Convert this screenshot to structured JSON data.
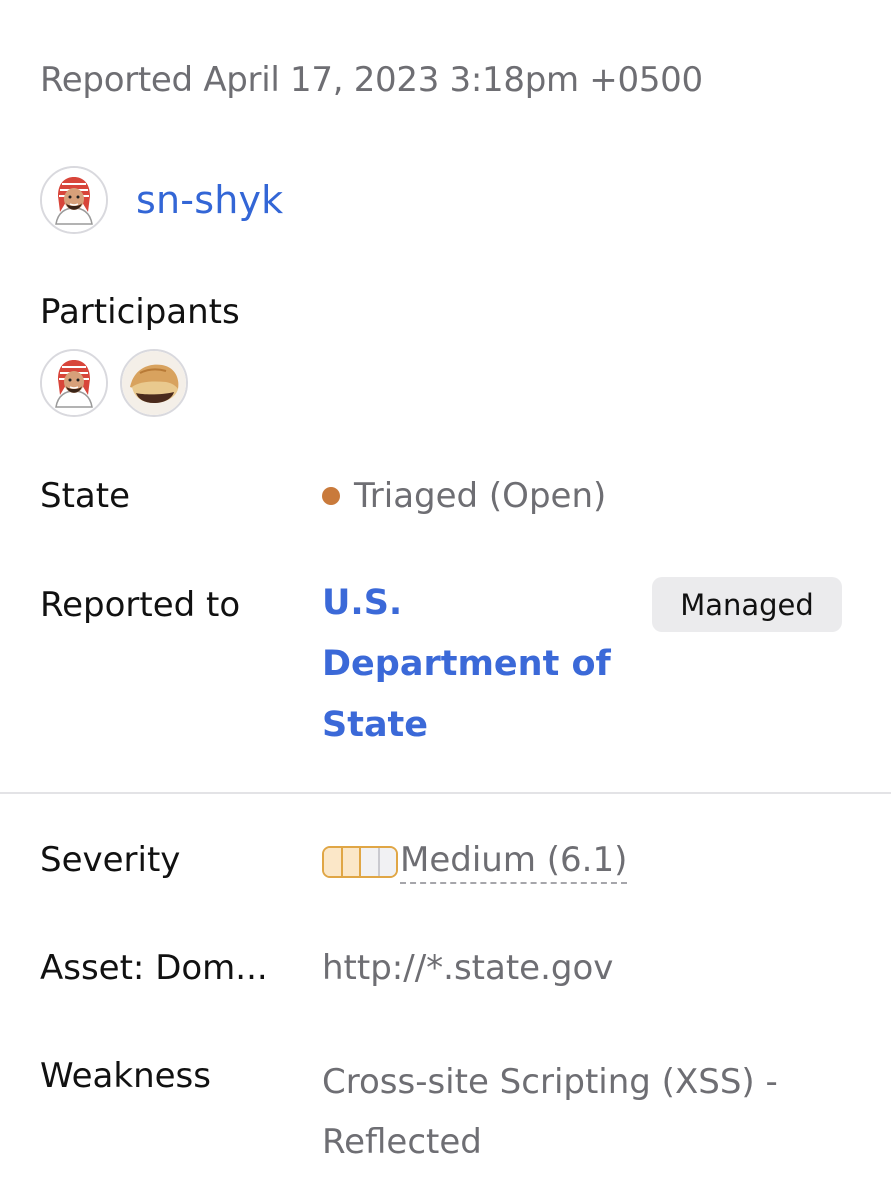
{
  "report": {
    "reported_date": "Reported April 17, 2023 3:18pm +0500"
  },
  "reporter": {
    "username": "sn-shyk",
    "avatar_icon": "reporter-avatar"
  },
  "participants": {
    "label": "Participants",
    "avatars": [
      "participant-avatar-sn-shyk",
      "participant-avatar-pastry"
    ]
  },
  "state": {
    "label": "State",
    "value": "Triaged (Open)",
    "dot_color": "#c97a3b"
  },
  "reported_to": {
    "label": "Reported to",
    "value": "U.S. Department of State",
    "badge": "Managed",
    "link_color": "#3b69d8"
  },
  "severity": {
    "label": "Severity",
    "value": "Medium (6.1)",
    "meter_level": "2 of 4",
    "meter_color": "#e0a645"
  },
  "asset": {
    "label": "Asset: Dom...",
    "value": "http://*.state.gov"
  },
  "weakness": {
    "label": "Weakness",
    "value": "Cross-site Scripting (XSS) - Reflected"
  }
}
